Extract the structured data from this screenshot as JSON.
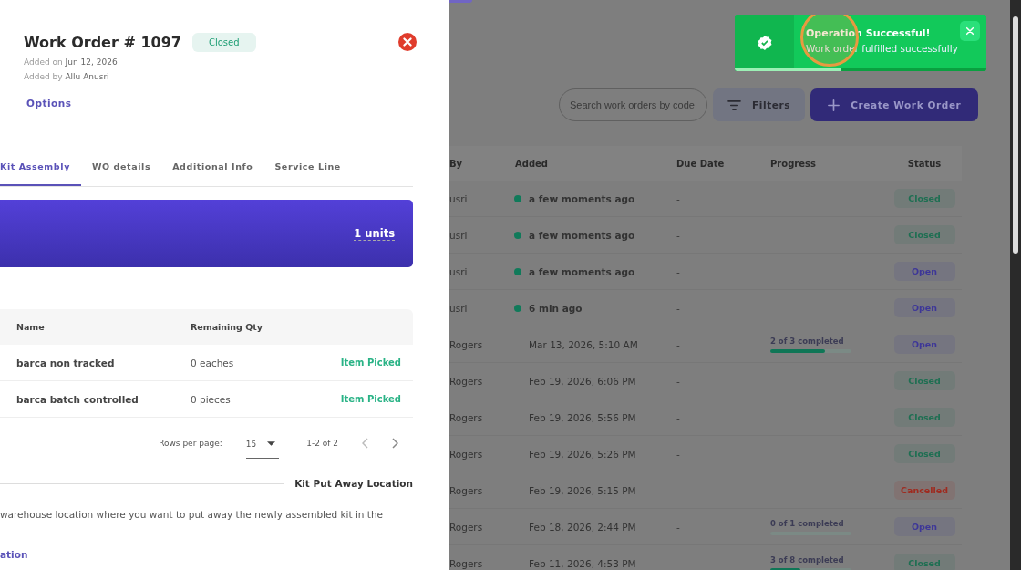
{
  "drawer": {
    "title": "Work Order # 1097",
    "status": {
      "label": "Closed",
      "color": "#1e9e74"
    },
    "added_on": {
      "label": "Added on",
      "value": "Jun 12, 2026"
    },
    "added_by": {
      "label": "Added by",
      "value": "Allu Anusri"
    },
    "options_link": "Options",
    "tabs": [
      {
        "label": "Kit Assembly",
        "selected": true
      },
      {
        "label": "WO details",
        "selected": false
      },
      {
        "label": "Additional Info",
        "selected": false
      },
      {
        "label": "Service Line",
        "selected": false
      }
    ],
    "banner": {
      "units": "1 units"
    },
    "items_table": {
      "columns": [
        "Name",
        "Remaining Qty"
      ],
      "rows": [
        {
          "name": "barca non tracked",
          "remaining": "0 eaches",
          "state": "Item Picked"
        },
        {
          "name": "barca batch controlled",
          "remaining": "0 pieces",
          "state": "Item Picked"
        }
      ]
    },
    "pagination": {
      "rows_per_page_label": "Rows per page:",
      "rows_per_page": "15",
      "range": "1-2 of 2"
    },
    "section_title": "Kit Put Away Location",
    "description": "warehouse location where you want to put away the newly assembled kit in the",
    "link_fragment": "ation"
  },
  "toast": {
    "title": "Operation Successful!",
    "message": "Work order fulfilled successfully",
    "level": 0.42
  },
  "toolbar": {
    "search_placeholder": "Search work orders by code",
    "filters": "Filters",
    "create": "Create Work Order"
  },
  "table": {
    "columns": [
      "By",
      "Added",
      "Due Date",
      "Progress",
      "Status"
    ],
    "rows": [
      {
        "by": "usri",
        "added": "a few moments ago",
        "recent": true,
        "due": "-",
        "status": {
          "label": "Closed",
          "color": "#1e6f52"
        }
      },
      {
        "by": "usri",
        "added": "a few moments ago",
        "recent": true,
        "due": "-",
        "status": {
          "label": "Closed",
          "color": "#1e6f52"
        }
      },
      {
        "by": "usri",
        "added": "a few moments ago",
        "recent": true,
        "due": "-",
        "status": {
          "label": "Open",
          "color": "#3d3698"
        }
      },
      {
        "by": "usri",
        "added": "6 min ago",
        "recent": true,
        "due": "-",
        "status": {
          "label": "Open",
          "color": "#3d3698"
        }
      },
      {
        "by": "Rogers",
        "added": "Mar 13, 2026, 5:10 AM",
        "recent": false,
        "due": "-",
        "progress": {
          "text": "2 of 3 completed",
          "level": 0.67
        },
        "status": {
          "label": "Open",
          "color": "#3d3698"
        }
      },
      {
        "by": "Rogers",
        "added": "Feb 19, 2026, 6:06 PM",
        "recent": false,
        "due": "-",
        "status": {
          "label": "Closed",
          "color": "#1e6f52"
        }
      },
      {
        "by": "Rogers",
        "added": "Feb 19, 2026, 5:56 PM",
        "recent": false,
        "due": "-",
        "status": {
          "label": "Closed",
          "color": "#1e6f52"
        }
      },
      {
        "by": "Rogers",
        "added": "Feb 19, 2026, 5:26 PM",
        "recent": false,
        "due": "-",
        "status": {
          "label": "Closed",
          "color": "#1e6f52"
        }
      },
      {
        "by": "Rogers",
        "added": "Feb 19, 2026, 5:15 PM",
        "recent": false,
        "due": "-",
        "status": {
          "label": "Cancelled",
          "color": "#9f2a1f"
        }
      },
      {
        "by": "Rogers",
        "added": "Feb 18, 2026, 2:44 PM",
        "recent": false,
        "due": "-",
        "progress": {
          "text": "0 of 1 completed",
          "level": 0
        },
        "status": {
          "label": "Open",
          "color": "#3d3698"
        }
      },
      {
        "by": "Rogers",
        "added": "Feb 11, 2026, 4:53 PM",
        "recent": false,
        "due": "-",
        "progress": {
          "text": "3 of 8 completed",
          "level": 0.375
        },
        "status": {
          "label": "Closed",
          "color": "#1e6f52"
        }
      }
    ]
  }
}
